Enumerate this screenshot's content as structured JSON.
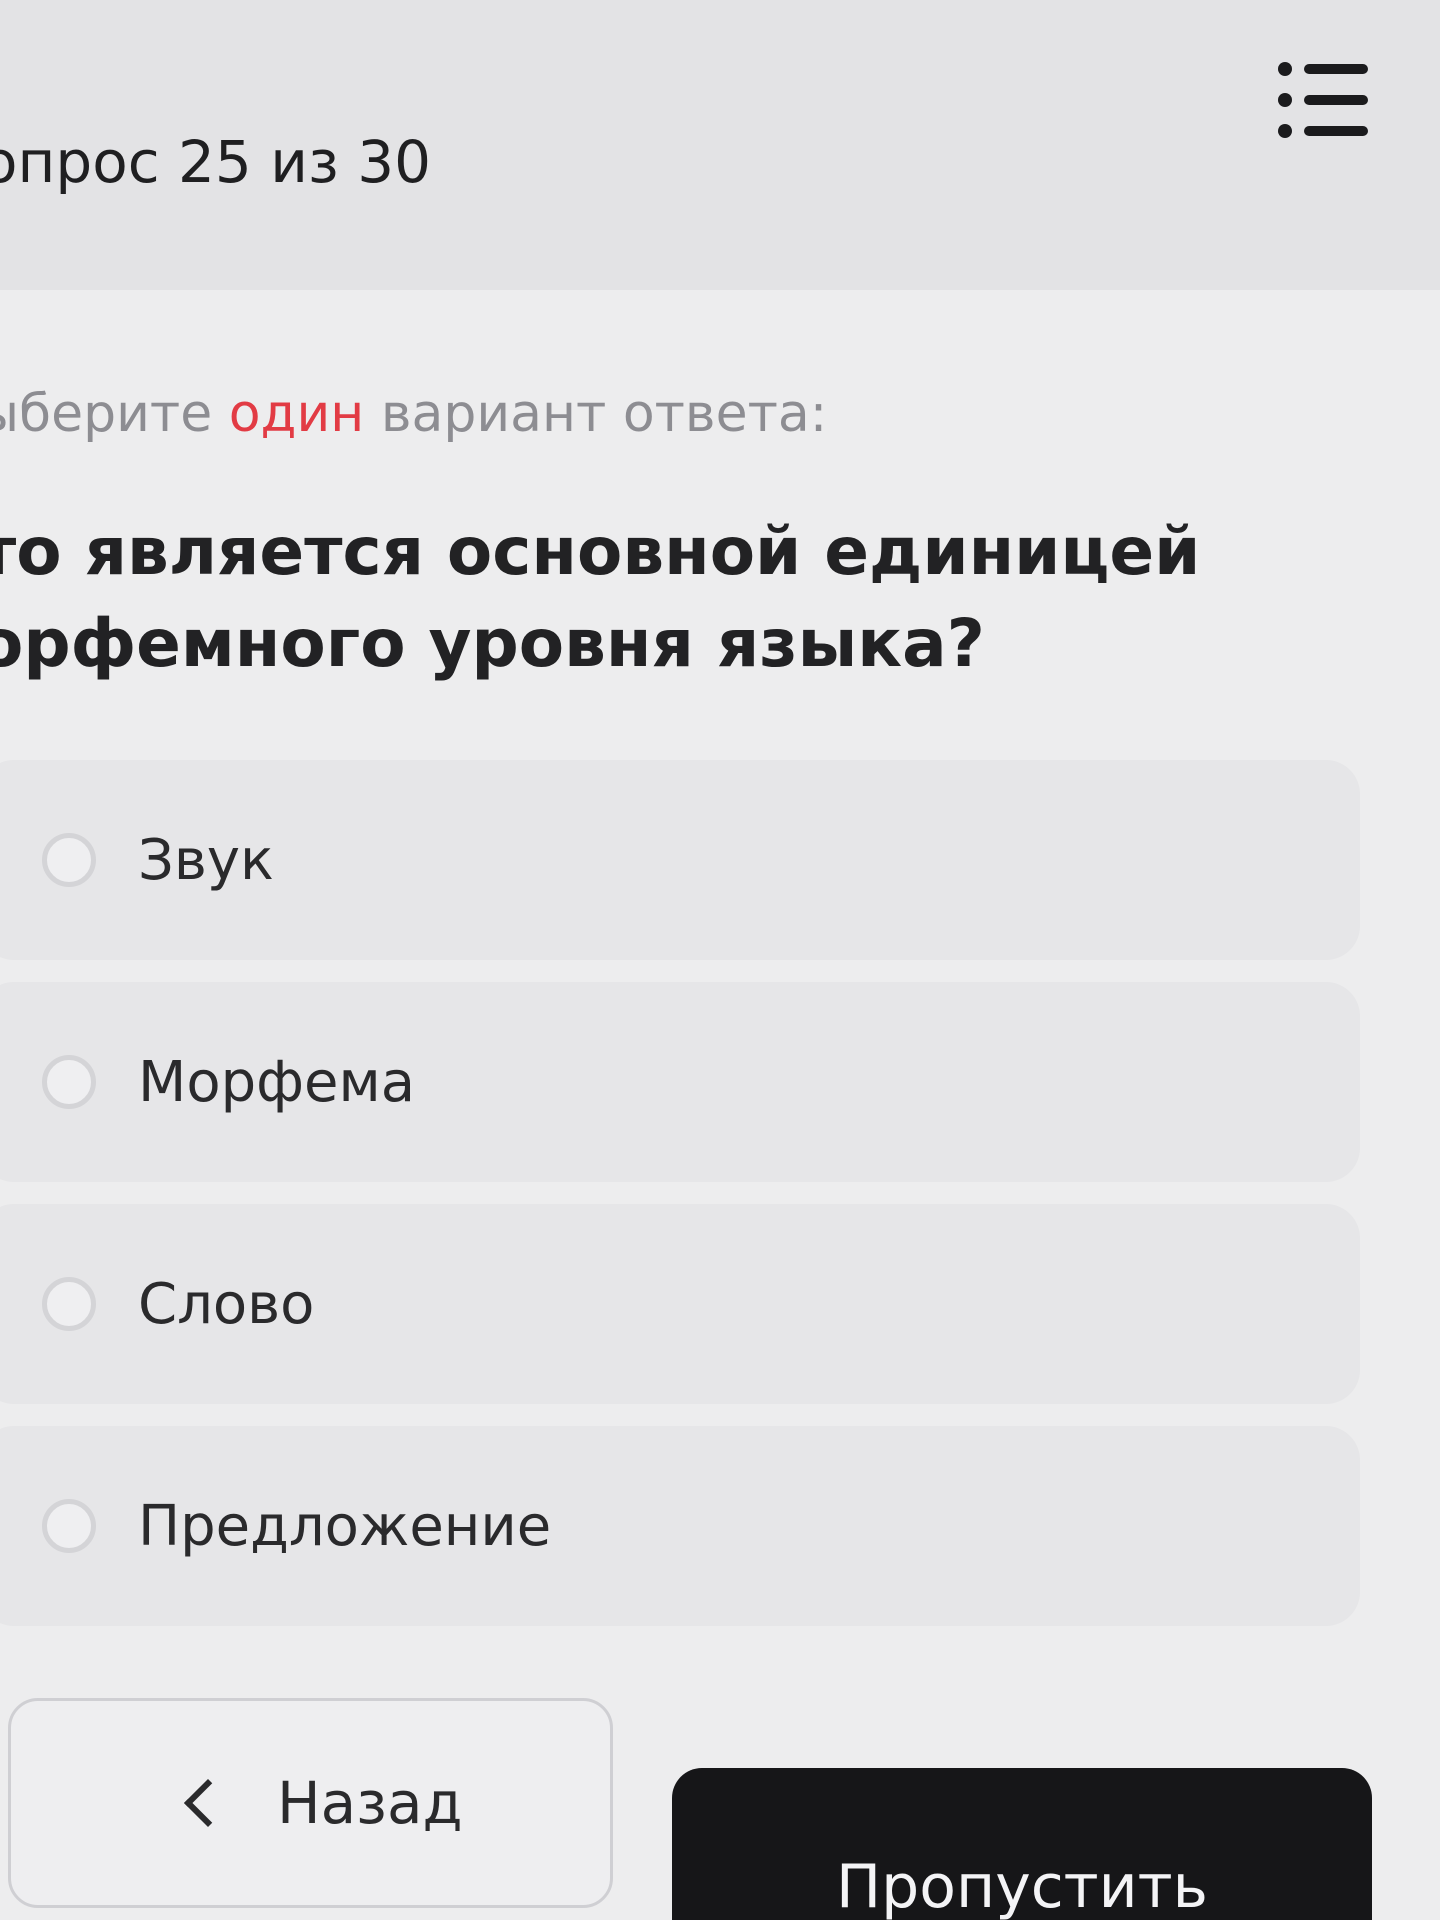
{
  "header": {
    "counter": "опрос 25 из 30",
    "menu_icon": "list-menu-icon"
  },
  "instruction": {
    "prefix": "ыберите ",
    "accent": "один",
    "suffix": " вариант ответа:",
    "accent_color": "#e23b44"
  },
  "question": {
    "line1": "то является основной единицей",
    "line2": "орфемного уровня языка?"
  },
  "options": [
    {
      "label": "Звук",
      "selected": false
    },
    {
      "label": "Морфема",
      "selected": false
    },
    {
      "label": "Слово",
      "selected": false
    },
    {
      "label": "Предложение",
      "selected": false
    }
  ],
  "footer": {
    "back_label": "Назад",
    "back_icon": "chevron-left-icon",
    "skip_label": "Пропустить"
  }
}
